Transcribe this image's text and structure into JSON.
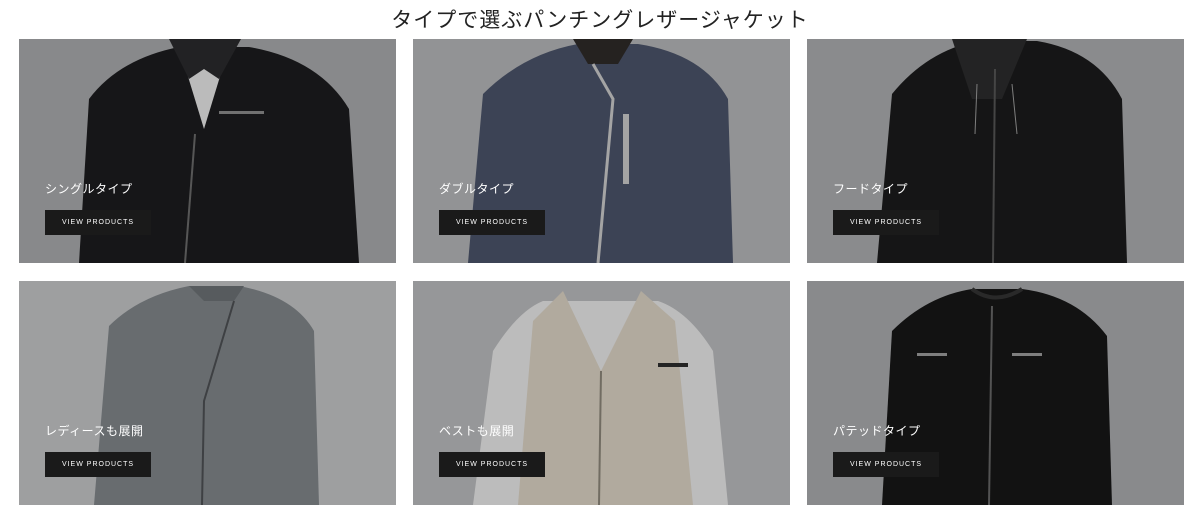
{
  "page": {
    "title": "タイプで選ぶパンチングレザージャケット"
  },
  "colors": {
    "button_bg": "#1a1a1a",
    "button_text": "#ffffff",
    "card_background": "#a9aaac"
  },
  "cards": [
    {
      "label": "シングルタイプ",
      "button": "VIEW PRODUCTS",
      "jacket_color": "#1c1c1e",
      "photo": "single-jacket-photo"
    },
    {
      "label": "ダブルタイプ",
      "button": "VIEW PRODUCTS",
      "jacket_color": "#4a5268",
      "photo": "double-jacket-photo"
    },
    {
      "label": "フードタイプ",
      "button": "VIEW PRODUCTS",
      "jacket_color": "#1a1a1b",
      "photo": "hood-jacket-photo"
    },
    {
      "label": "レディースも展開",
      "button": "VIEW PRODUCTS",
      "jacket_color": "#7f8488",
      "photo": "ladies-jacket-photo"
    },
    {
      "label": "ベストも展開",
      "button": "VIEW PRODUCTS",
      "jacket_color": "#d8d0c1",
      "photo": "vest-photo"
    },
    {
      "label": "パテッドタイプ",
      "button": "VIEW PRODUCTS",
      "jacket_color": "#161617",
      "photo": "padded-jacket-photo"
    }
  ]
}
